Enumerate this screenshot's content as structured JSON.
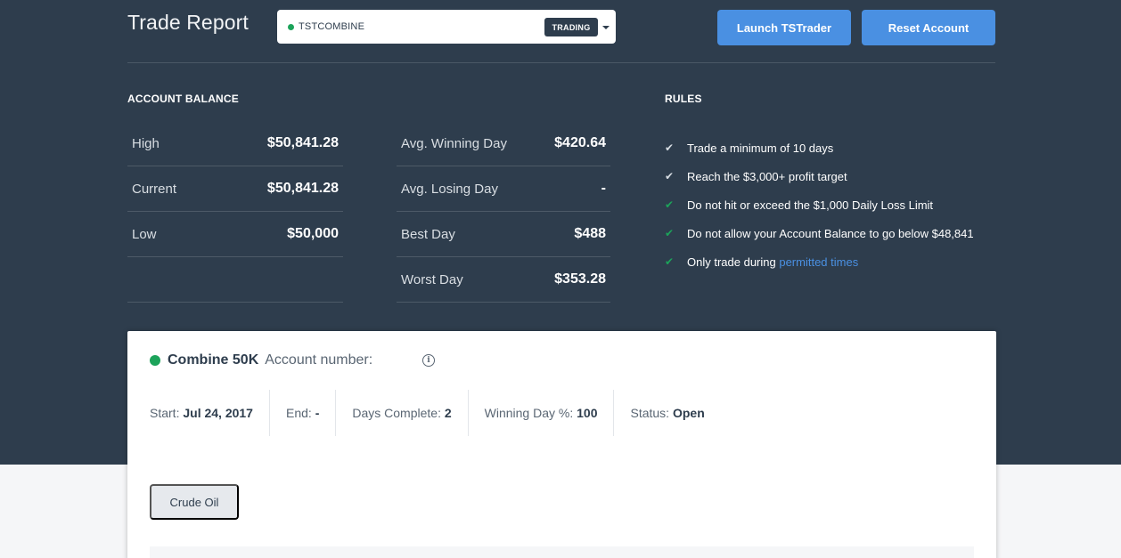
{
  "header": {
    "title": "Trade Report",
    "account_select": {
      "name": "TSTCOMBINE",
      "badge": "TRADING"
    },
    "launch_button": "Launch TSTrader",
    "reset_button": "Reset Account"
  },
  "balance": {
    "heading": "ACCOUNT BALANCE",
    "left": [
      {
        "label": "High",
        "value": "$50,841.28"
      },
      {
        "label": "Current",
        "value": "$50,841.28"
      },
      {
        "label": "Low",
        "value": "$50,000"
      }
    ],
    "right": [
      {
        "label": "Avg. Winning Day",
        "value": "$420.64"
      },
      {
        "label": "Avg. Losing Day",
        "value": "-"
      },
      {
        "label": "Best Day",
        "value": "$488"
      },
      {
        "label": "Worst Day",
        "value": "$353.28"
      }
    ]
  },
  "rules": {
    "heading": "RULES",
    "items": [
      {
        "text": "Trade a minimum of 10 days",
        "status": "done"
      },
      {
        "text": "Reach the $3,000+ profit target",
        "status": "done"
      },
      {
        "text": "Do not hit or exceed the $1,000 Daily Loss Limit",
        "status": "ok"
      },
      {
        "text": "Do not allow your Account Balance to go below $48,841",
        "status": "ok"
      },
      {
        "text": "Only trade during ",
        "status": "ok",
        "link": "permitted times"
      }
    ]
  },
  "card": {
    "title": "Combine 50K",
    "account_number_label": "Account number:",
    "account_number": "",
    "meta": {
      "start_label": "Start:",
      "start_value": "Jul 24, 2017",
      "end_label": "End:",
      "end_value": "-",
      "days_label": "Days Complete:",
      "days_value": "2",
      "winning_label": "Winning Day %:",
      "winning_value": "100",
      "status_label": "Status:",
      "status_value": "Open"
    },
    "product_tab": "Crude Oil"
  },
  "colors": {
    "header_bg": "#2e3d4d",
    "accent": "#4a90e2",
    "success": "#1ca35a"
  }
}
